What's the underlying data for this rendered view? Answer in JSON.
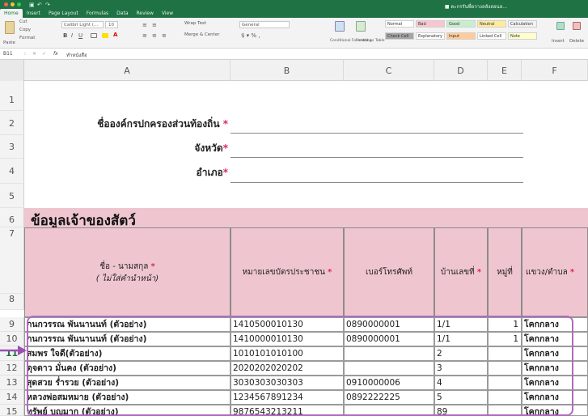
{
  "window": {
    "title": "■ ตะกรรันพื่อวางลลังลอนล..."
  },
  "ribbon": {
    "tabs": [
      "Home",
      "Insert",
      "Page Layout",
      "Formulas",
      "Data",
      "Review",
      "View"
    ],
    "clipboard": {
      "cut": "Cut",
      "copy": "Copy",
      "format": "Format"
    },
    "paste_label": "Paste",
    "font_name": "Calibri Light (...",
    "font_size": "10",
    "wrap_text": "Wrap Text",
    "merge_center": "Merge & Center",
    "number_format": "General",
    "conditional_formatting": "Conditional Formatting",
    "format_as_table": "Format as Table",
    "styles": [
      {
        "label": "Normal",
        "color": "#ffffff"
      },
      {
        "label": "Bad",
        "color": "#f7c6ce"
      },
      {
        "label": "Good",
        "color": "#c6efce"
      },
      {
        "label": "Neutral",
        "color": "#ffeb9c"
      },
      {
        "label": "Calculation",
        "color": "#f2f2f2"
      },
      {
        "label": "Check Cell",
        "color": "#a5a5a5"
      },
      {
        "label": "Explanatory",
        "color": "#ffffff"
      },
      {
        "label": "Input",
        "color": "#ffcc99"
      },
      {
        "label": "Linked Cell",
        "color": "#ffffff"
      },
      {
        "label": "Note",
        "color": "#ffffcc"
      }
    ],
    "insert": "Insert",
    "delete": "Delete"
  },
  "formula_bar": {
    "cell_ref": "B11",
    "fx": "fx",
    "value": "ทำหนังสือ"
  },
  "columns": [
    "A",
    "B",
    "C",
    "D",
    "E",
    "F"
  ],
  "rows": [
    "1",
    "2",
    "3",
    "4",
    "5",
    "6",
    "7",
    "8",
    "9",
    "10",
    "11",
    "12",
    "13",
    "14",
    "15"
  ],
  "form": {
    "org_label": "ชื่อองค์กรปกครองส่วนท้องถิ่น",
    "province_label": "จังหวัด",
    "district_label": "อำเภอ",
    "required_mark": "*"
  },
  "section_title": "ข้อมูลเจ้าของสัตว์",
  "table_headers": {
    "name": "ชื่อ - นามสกุล",
    "name_note": "( ไม่ใส่คำนำหน้า)",
    "id_number": "หมายเลขบัตรประชาชน",
    "phone": "เบอร์โทรศัพท์",
    "house_no": "บ้านเลขที่",
    "moo": "หมู่ที่",
    "subdistrict": "แขวง/ตำบล"
  },
  "table_rows": [
    {
      "name": "กนกวรรณ พันนานนท์ (ตัวอย่าง)",
      "id": "1410500010130",
      "phone": "0890000001",
      "house": "1/1",
      "moo": "1",
      "subdistrict": "โคกกลาง"
    },
    {
      "name": "กนกวรรณ พันนานนท์ (ตัวอย่าง)",
      "id": "1410000010130",
      "phone": "0890000001",
      "house": "1/1",
      "moo": "1",
      "subdistrict": "โคกกลาง"
    },
    {
      "name": "สมพร ใจดี(ตัวอย่าง)",
      "id": "1010101010100",
      "phone": "",
      "house": "2",
      "moo": "",
      "subdistrict": "โคกกลาง"
    },
    {
      "name": "ดุจดาว มั่นคง (ตัวอย่าง)",
      "id": "2020202020202",
      "phone": "",
      "house": "3",
      "moo": "",
      "subdistrict": "โคกกลาง"
    },
    {
      "name": "สุดสวย ร่ำรวย (ตัวอย่าง)",
      "id": "3030303030303",
      "phone": "0910000006",
      "house": "4",
      "moo": "",
      "subdistrict": "โคกกลาง"
    },
    {
      "name": "หลวงพ่อสมหมาย (ตัวอย่าง)",
      "id": "1234567891234",
      "phone": "0892222225",
      "house": "5",
      "moo": "",
      "subdistrict": "โคกกลาง"
    },
    {
      "name": "ทรัพย์ บุญมาก (ตัวอย่าง)",
      "id": "9876543213211",
      "phone": "",
      "house": "89",
      "moo": "",
      "subdistrict": "โคกกลาง"
    }
  ],
  "colors": {
    "excel_green": "#1f7244",
    "header_pink": "#efc6d0",
    "highlight_purple": "#b06ac0",
    "required_red": "#e0245e"
  }
}
